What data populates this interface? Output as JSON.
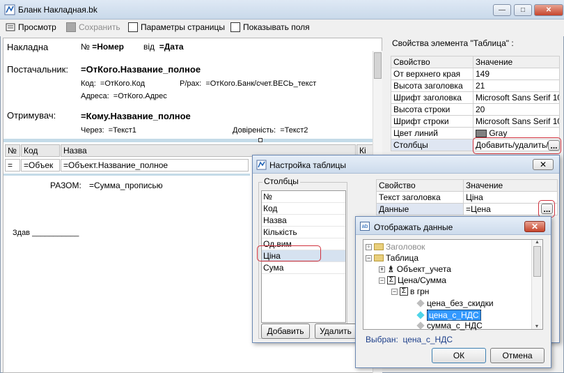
{
  "main": {
    "title": "Бланк  Накладная.bk",
    "toolbar": {
      "preview": "Просмотр",
      "save": "Сохранить",
      "page_params": "Параметры страницы",
      "show_fields": "Показывать поля"
    },
    "form": {
      "nakladna": "Накладна",
      "num_label": "№",
      "num_value": "=Номер",
      "from_label": "від",
      "date_value": "=Дата",
      "supplier_label": "Постачальник:",
      "supplier_value": "=ОтКого.Название_полное",
      "code_label": "Код:",
      "code_value": "=ОтКого.Код",
      "account_label": "Р/рах:",
      "account_value": "=ОтКого.Банк/счет.ВЕСЬ_текст",
      "address_label": "Адреса:",
      "address_value": "=ОтКого.Адрес",
      "receiver_label": "Отримувач:",
      "receiver_value": "=Кому.Название_полное",
      "through_label": "Через:",
      "through_value": "=Текст1",
      "trust_label": "Довіреність:",
      "trust_value": "=Текст2",
      "table_headers": [
        "№",
        "Код",
        "Назва",
        "Кі"
      ],
      "table_row": [
        "=",
        "=Объек",
        "=Объект.Название_полное"
      ],
      "total_label": "РАЗОМ:",
      "total_value": "=Сумма_прописью",
      "handed_label": "Здав ___________"
    }
  },
  "props": {
    "title": "Свойства элемента \"Таблица\" :",
    "headers": [
      "Свойство",
      "Значение"
    ],
    "rows": [
      [
        "От верхнего края",
        "149"
      ],
      [
        "Высота заголовка",
        "21"
      ],
      [
        "Шрифт заголовка",
        "Microsoft Sans Serif 10"
      ],
      [
        "Высота строки",
        "20"
      ],
      [
        "Шрифт строки",
        "Microsoft Sans Serif 10"
      ],
      [
        "Цвет линий",
        "Gray"
      ],
      [
        "Столбцы",
        "Добавить/удалить/и"
      ]
    ],
    "ellipsis": "..."
  },
  "table_dialog": {
    "title": "Настройка таблицы",
    "columns_group": "Столбцы",
    "columns": [
      "№",
      "Код",
      "Назва",
      "Кількість",
      "Од.вим",
      "Ціна",
      "Сума"
    ],
    "selected_column": "Ціна",
    "add_button": "Добавить",
    "delete_button": "Удалить",
    "headers": [
      "Свойство",
      "Значение"
    ],
    "rows": [
      [
        "Текст заголовка",
        "Ціна"
      ],
      [
        "Данные",
        "=Цена"
      ]
    ],
    "ellipsis": "..."
  },
  "data_dialog": {
    "title": "Отображать данные",
    "tree": [
      "Заголовок",
      "Таблица",
      "Объект_учета",
      "Цена/Сумма",
      "в грн",
      "цена_без_скидки",
      "цена_с_НДС",
      "сумма_с_НДС"
    ],
    "selected_label": "Выбран:",
    "selected_value": "цена_с_НДС",
    "ok_button": "ОК",
    "cancel_button": "Отмена"
  },
  "colors": {
    "selection": "#3399ff",
    "highlight_border": "#d0303c",
    "gray_swatch": "#808080"
  }
}
